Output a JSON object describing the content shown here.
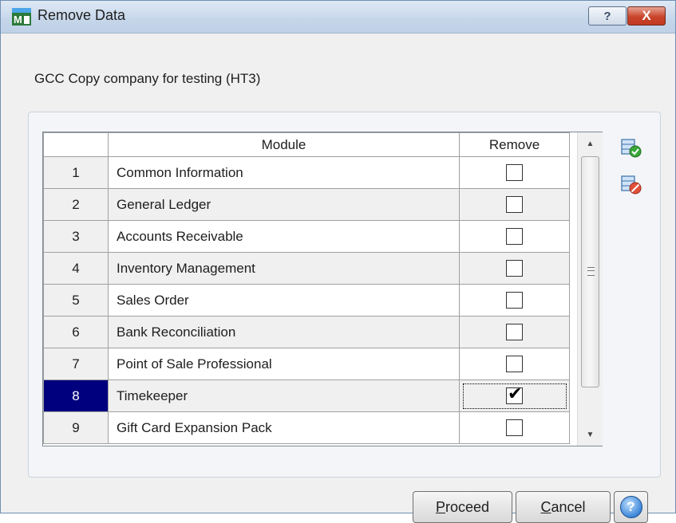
{
  "window": {
    "title": "Remove Data",
    "help_label": "?",
    "close_label": "X"
  },
  "company_label": "GCC Copy company for testing (HT3)",
  "grid": {
    "columns": [
      "",
      "Module",
      "Remove"
    ],
    "rows": [
      {
        "num": "1",
        "module": "Common Information",
        "remove": false
      },
      {
        "num": "2",
        "module": "General Ledger",
        "remove": false
      },
      {
        "num": "3",
        "module": "Accounts Receivable",
        "remove": false
      },
      {
        "num": "4",
        "module": "Inventory Management",
        "remove": false
      },
      {
        "num": "5",
        "module": "Sales Order",
        "remove": false
      },
      {
        "num": "6",
        "module": "Bank Reconciliation",
        "remove": false
      },
      {
        "num": "7",
        "module": "Point of Sale Professional",
        "remove": false
      },
      {
        "num": "8",
        "module": "Timekeeper",
        "remove": true,
        "selected": true
      },
      {
        "num": "9",
        "module": "Gift Card Expansion Pack",
        "remove": false
      }
    ]
  },
  "side_icons": [
    "select-all-icon",
    "clear-all-icon"
  ],
  "buttons": {
    "proceed_prefix": "",
    "proceed_accel": "P",
    "proceed_rest": "roceed",
    "cancel_prefix": "",
    "cancel_accel": "C",
    "cancel_rest": "ancel",
    "help_label": "?"
  },
  "colors": {
    "selected_row": "#00007f",
    "close_button": "#c9452c"
  }
}
